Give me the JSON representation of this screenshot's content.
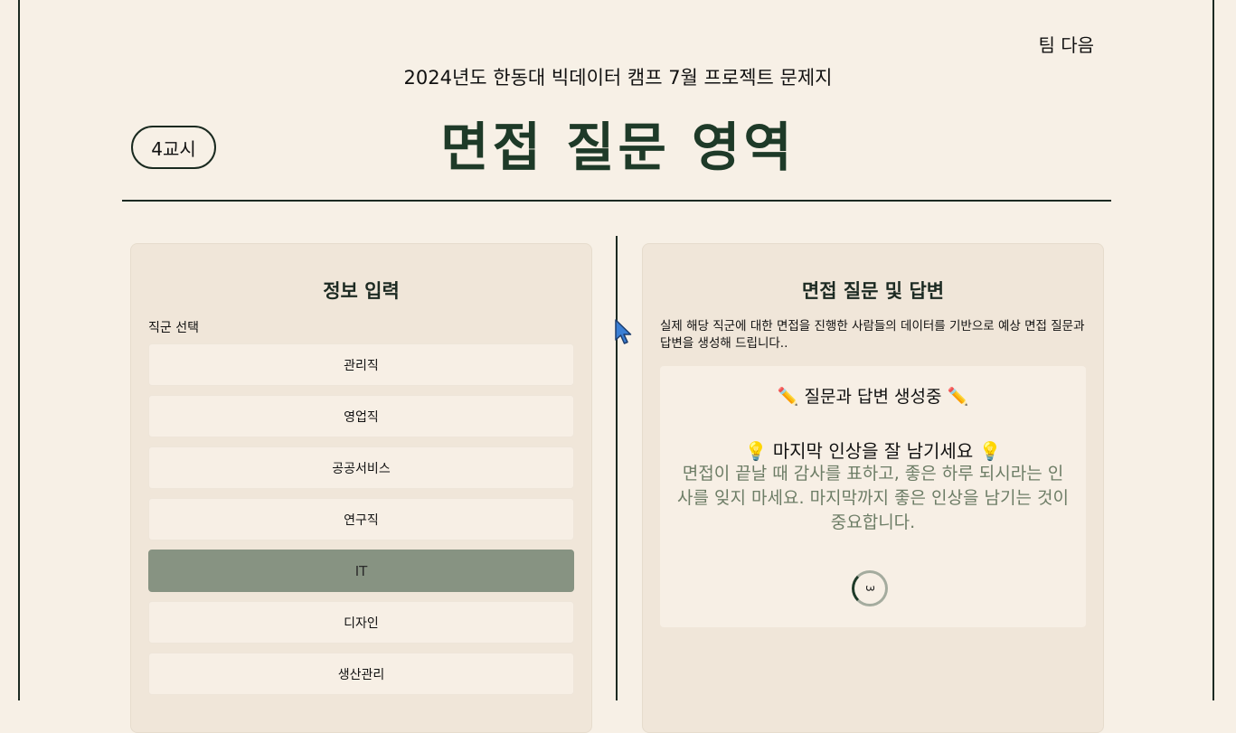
{
  "header": {
    "team_name": "팀 다음",
    "subtitle": "2024년도 한동대 빅데이터 캠프 7월 프로젝트 문제지",
    "period_badge": "4교시",
    "title": "면접 질문 영역"
  },
  "left_panel": {
    "title": "정보 입력",
    "job_label": "직군 선택",
    "jobs": [
      {
        "label": "관리직",
        "selected": false
      },
      {
        "label": "영업직",
        "selected": false
      },
      {
        "label": "공공서비스",
        "selected": false
      },
      {
        "label": "연구직",
        "selected": false
      },
      {
        "label": "IT",
        "selected": true
      },
      {
        "label": "디자인",
        "selected": false
      },
      {
        "label": "생산관리",
        "selected": false
      }
    ]
  },
  "right_panel": {
    "title": "면접 질문 및 답변",
    "description": "실제 해당 직군에 대한 면접을 진행한 사람들의 데이터를 기반으로 예상 면접 질문과 답변을 생성해 드립니다..",
    "status": "✏️ 질문과 답변 생성중 ✏️",
    "tip_title": "💡 마지막 인상을 잘 남기세요 💡",
    "tip_body": "면접이 끝날 때 감사를 표하고, 좋은 하루 되시라는 인사를 잊지 마세요. 마지막까지 좋은 인상을 남기는 것이 중요합니다.",
    "countdown": "3"
  },
  "colors": {
    "background": "#f7f0e6",
    "panel": "#f0e6d9",
    "accent_dark": "#1e3a28",
    "selected": "#879382",
    "tip_text": "#6d7d66"
  },
  "icons": [
    "pencil-icon",
    "lightbulb-icon",
    "loading-spinner",
    "mouse-cursor-icon"
  ]
}
